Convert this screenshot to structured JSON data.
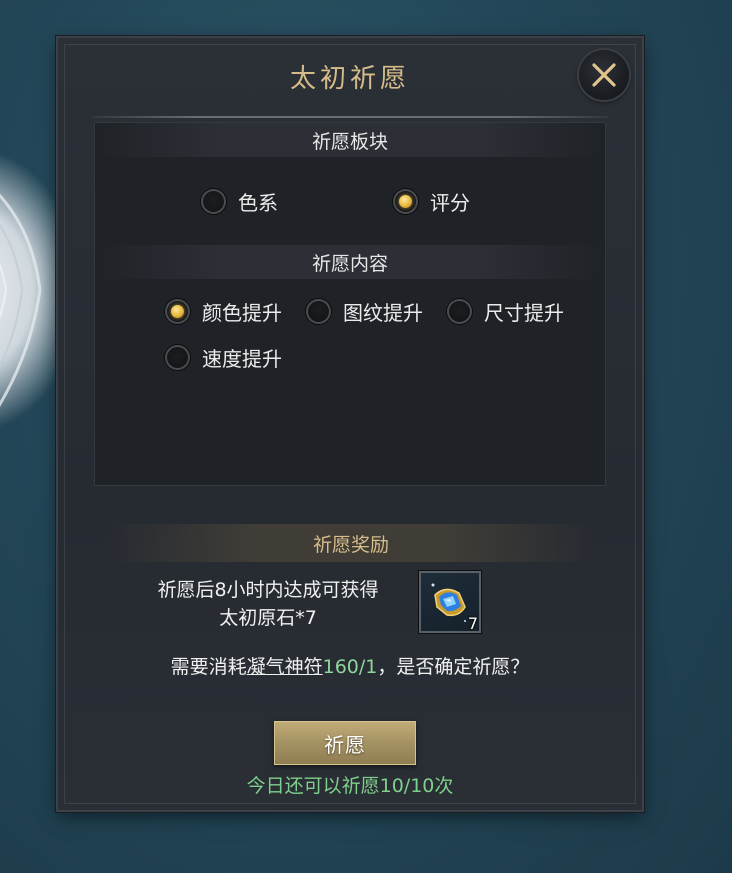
{
  "dialog": {
    "title": "太初祈愿",
    "close_icon": "close-icon"
  },
  "wish_section": {
    "header": "祈愿板块",
    "options": [
      {
        "label": "色系",
        "selected": false
      },
      {
        "label": "评分",
        "selected": true
      }
    ]
  },
  "content_section": {
    "header": "祈愿内容",
    "options": [
      {
        "label": "颜色提升",
        "selected": true
      },
      {
        "label": "图纹提升",
        "selected": false
      },
      {
        "label": "尺寸提升",
        "selected": false
      },
      {
        "label": "速度提升",
        "selected": false
      }
    ]
  },
  "reward": {
    "header": "祈愿奖励",
    "line1": "祈愿后8小时内达成可获得",
    "line2": "太初原石*7",
    "item_icon": "blue-crystal-icon",
    "item_count": "7"
  },
  "cost": {
    "prefix": "需要消耗",
    "item_name": "凝气神符",
    "amount": "160/1",
    "suffix": "，是否确定祈愿？"
  },
  "confirm_button": "祈愿",
  "remaining_text": "今日还可以祈愿10/10次",
  "colors": {
    "title_gold": "#d6bc8a",
    "selected_gold": "#e6b93e",
    "green_text": "#7fd08b",
    "panel_bg": "#262a31",
    "background_teal": "#234758"
  }
}
